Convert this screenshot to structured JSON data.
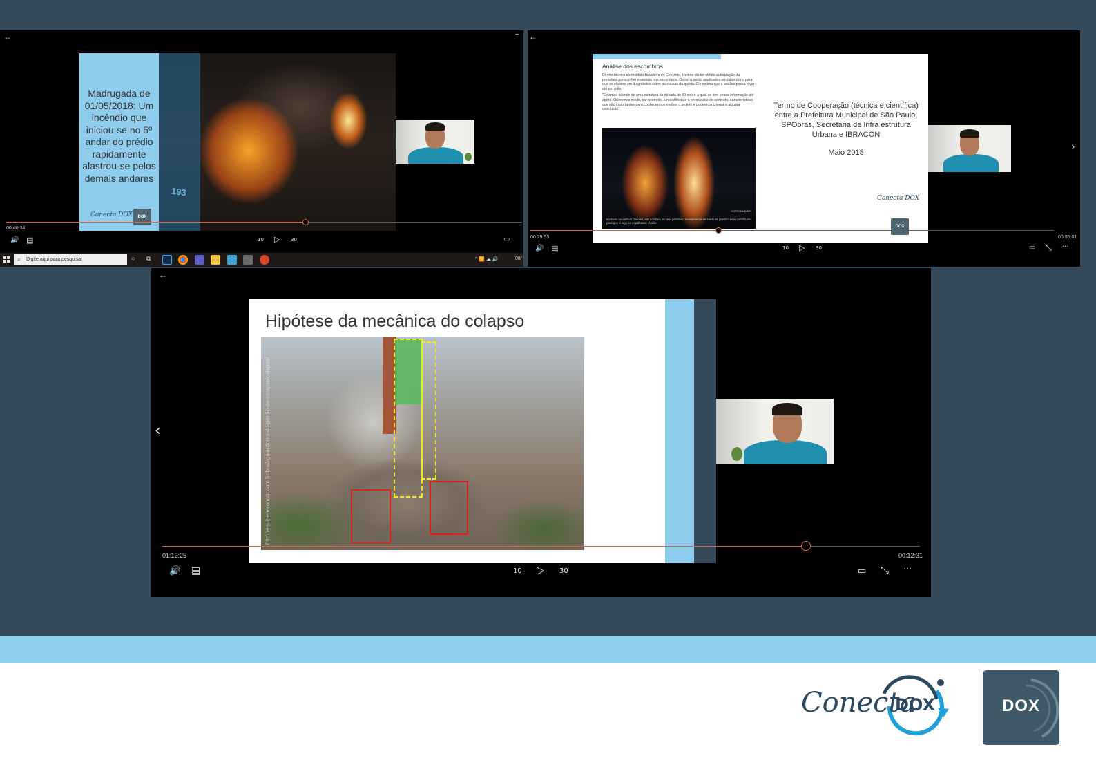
{
  "players": [
    {
      "id": "player-1",
      "slide_caption": "Madrugada de 01/05/2018: Um incêndio que iniciou-se no 5º andar do prédio rapidamente alastrou-se pelos demais andares",
      "photo_label": "193",
      "logo_text": "Conecta DOX",
      "logo_box_text": "DOX",
      "time_elapsed": "00:46:34",
      "progress": 0.58
    },
    {
      "id": "player-2",
      "slide_title": "Análise dos escombros",
      "slide_text_1": "Diretor técnico do Instituto Brasileiro do Concreto, Helene diz ter obtido autorização da prefeitura para colher materiais nos escombros. Os itens serão analisados em laboratório para que se elabore um diagnóstico sobre as causas da queda. Ele estima que a análise possa levar até um mês.",
      "slide_text_2": "\"Estamos falando de uma estrutura da década de 60 sobre a qual se tem pouca informação até agora. Queremos medir, por exemplo, a resistência e a porosidade do concreto, características que são importantes para conhecermos melhor o projeto e podermos chegar a alguma conclusão\".",
      "photo_credit": "REPRODUÇÃO",
      "photo_caption": "Incêndio no edifício Grenfell, em Londres, no ano passado: revestimento derivado de plástico teria contribuído para que o fogo se espalhasse rápido",
      "right_text": "Termo de Cooperação (técnica e científica) entre a Prefeitura Municipal de São Paulo, SPObras, Secretaria de Infra estrutura Urbana e IBRACON",
      "right_date": "Maio 2018",
      "logo_text": "Conecta DOX",
      "logo_box_text": "DOX",
      "time_elapsed": "00:29:55",
      "time_remaining": "00:55:01",
      "progress": 0.36
    },
    {
      "id": "player-3",
      "slide_title": "Hipótese da mecânica do colapso",
      "photo_source": "http://equipeaeronaut.com.br/bra2/galardores-do-predio-de-colapso/colapso/",
      "time_elapsed": "01:12:25",
      "time_remaining": "00:12:31",
      "progress": 0.85
    }
  ],
  "controls": {
    "back_icon": "←",
    "volume_icon": "🔊",
    "captions_icon": "▤",
    "rewind_label": "10",
    "play_icon": "▷",
    "forward_label": "30",
    "miniplayer_icon": "▭",
    "fullscreen_icon": "⤡",
    "more_icon": "···",
    "prev_icon": "‹",
    "next_icon": "›"
  },
  "taskbar": {
    "search_placeholder": "Digite aqui para pesquisar",
    "tray_text": "^ 🛜 ☁ 🔊",
    "clock": "08/"
  },
  "footer": {
    "brand_script": "Conecta",
    "brand_box": "DOX",
    "dox_logo_text": "DOX"
  },
  "colors": {
    "background_dark": "#34495a",
    "accent_light_blue": "#92d0ef",
    "progress_orange": "#e2643d",
    "brand_navy": "#2c4a5f",
    "brand_cyan": "#1ea0d8"
  }
}
